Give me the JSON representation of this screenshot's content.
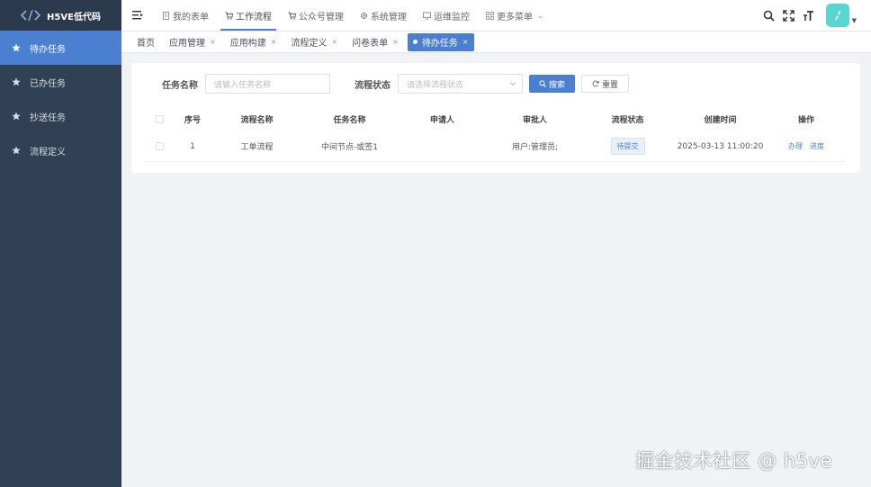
{
  "app": {
    "logo_text": "H5VE低代码"
  },
  "sidebar": {
    "items": [
      {
        "label": "待办任务",
        "active": true
      },
      {
        "label": "已办任务",
        "active": false
      },
      {
        "label": "抄送任务",
        "active": false
      },
      {
        "label": "流程定义",
        "active": false
      }
    ]
  },
  "header": {
    "menus": [
      {
        "label": "我的表单",
        "icon": "form-icon"
      },
      {
        "label": "工作流程",
        "icon": "cart-icon",
        "active": true
      },
      {
        "label": "公众号管理",
        "icon": "cart-icon"
      },
      {
        "label": "系统管理",
        "icon": "gear-icon"
      },
      {
        "label": "运维监控",
        "icon": "monitor-icon"
      },
      {
        "label": "更多菜单",
        "icon": "grid-icon"
      }
    ]
  },
  "tags": {
    "home": "首页",
    "items": [
      {
        "label": "应用管理"
      },
      {
        "label": "应用构建"
      },
      {
        "label": "流程定义"
      },
      {
        "label": "问卷表单"
      },
      {
        "label": "待办任务",
        "active": true
      }
    ]
  },
  "filters": {
    "task_name_label": "任务名称",
    "task_name_placeholder": "请输入任务名称",
    "status_label": "流程状态",
    "status_placeholder": "请选择流程状态",
    "search_label": "搜索",
    "reset_label": "重置"
  },
  "table": {
    "headers": [
      "序号",
      "流程名称",
      "任务名称",
      "申请人",
      "审批人",
      "流程状态",
      "创建时间",
      "操作"
    ],
    "rows": [
      {
        "index": "1",
        "process_name": "工单流程",
        "task_name": "中间节点-或签1",
        "applicant": "",
        "approver": "用户:管理员;",
        "status": "待提交",
        "created": "2025-03-13 11:00:20",
        "actions": [
          "办理",
          "进度"
        ]
      }
    ]
  },
  "watermark": "掘金技术社区 @ h5ve",
  "colors": {
    "sidebar": "#304156",
    "accent": "#4a7fd1",
    "avatar": "#58d6d1"
  }
}
